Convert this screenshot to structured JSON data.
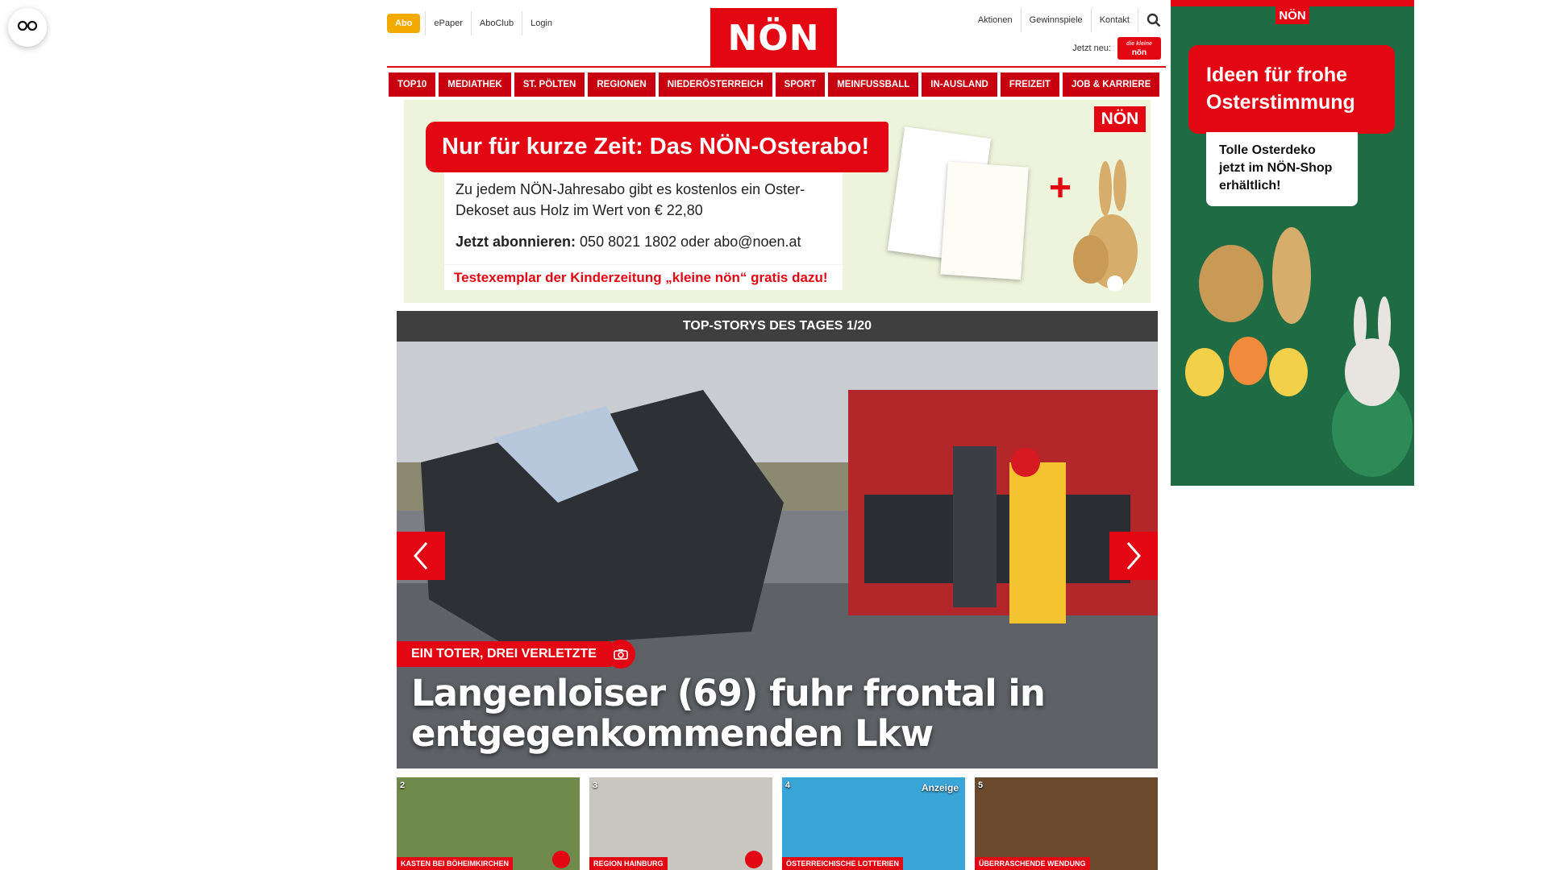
{
  "floating": {
    "icon": "glasses-icon"
  },
  "header": {
    "abo_label": "Abo",
    "top_links": [
      "ePaper",
      "AboClub",
      "Login"
    ],
    "logo_text": "NÖN",
    "right_links": [
      "Aktionen",
      "Gewinnspiele",
      "Kontakt"
    ],
    "jetzt_neu_label": "Jetzt neu:",
    "jetzt_logo_top": "die kleine",
    "jetzt_logo_bottom": "nön"
  },
  "nav": {
    "items": [
      "TOP10",
      "MEDIATHEK",
      "ST. PÖLTEN",
      "REGIONEN",
      "NIEDERÖSTERREICH",
      "SPORT",
      "MEINFUSSBALL",
      "IN-AUSLAND",
      "FREIZEIT",
      "JOB & KARRIERE"
    ]
  },
  "promo": {
    "title": "Nur für kurze Zeit: Das NÖN-Osterabo!",
    "text": "Zu jedem NÖN-Jahresabo gibt es kostenlos ein Oster-Dekoset aus Holz im Wert von € 22,80",
    "sub_bold": "Jetzt abonnieren:",
    "sub_text": "050 8021 1802 oder abo@noen.at",
    "red_line": "Testexemplar der Kinderzeitung „kleine nön“ gratis dazu!",
    "logo": "NÖN",
    "plus": "+"
  },
  "stories": {
    "bar_title": "TOP-STORYS DES TAGES 1/20",
    "hero_tag": "EIN TOTER, DREI VERLETZTE",
    "hero_title": "Langenloiser (69) fuhr frontal in entgegenkommenden Lkw"
  },
  "thumbs": [
    {
      "num": "2",
      "label": "KASTEN BEI BÖHEIMKIRCHEN",
      "badge": "",
      "bg": "#6f8a4a"
    },
    {
      "num": "3",
      "label": "REGION HAINBURG",
      "badge": "",
      "bg": "#c9c6c0"
    },
    {
      "num": "4",
      "label": "ÖSTERREICHISCHE LOTTERIEN",
      "badge": "Anzeige",
      "bg": "#3aa6d8"
    },
    {
      "num": "5",
      "label": "ÜBERRASCHENDE WENDUNG",
      "badge": "",
      "bg": "#6b4a2e"
    }
  ],
  "ad": {
    "logo": "NÖN",
    "headline": "Ideen für frohe Osterstimmung",
    "sub": "Tolle Osterdeko jetzt im NÖN-Shop erhältlich!"
  }
}
